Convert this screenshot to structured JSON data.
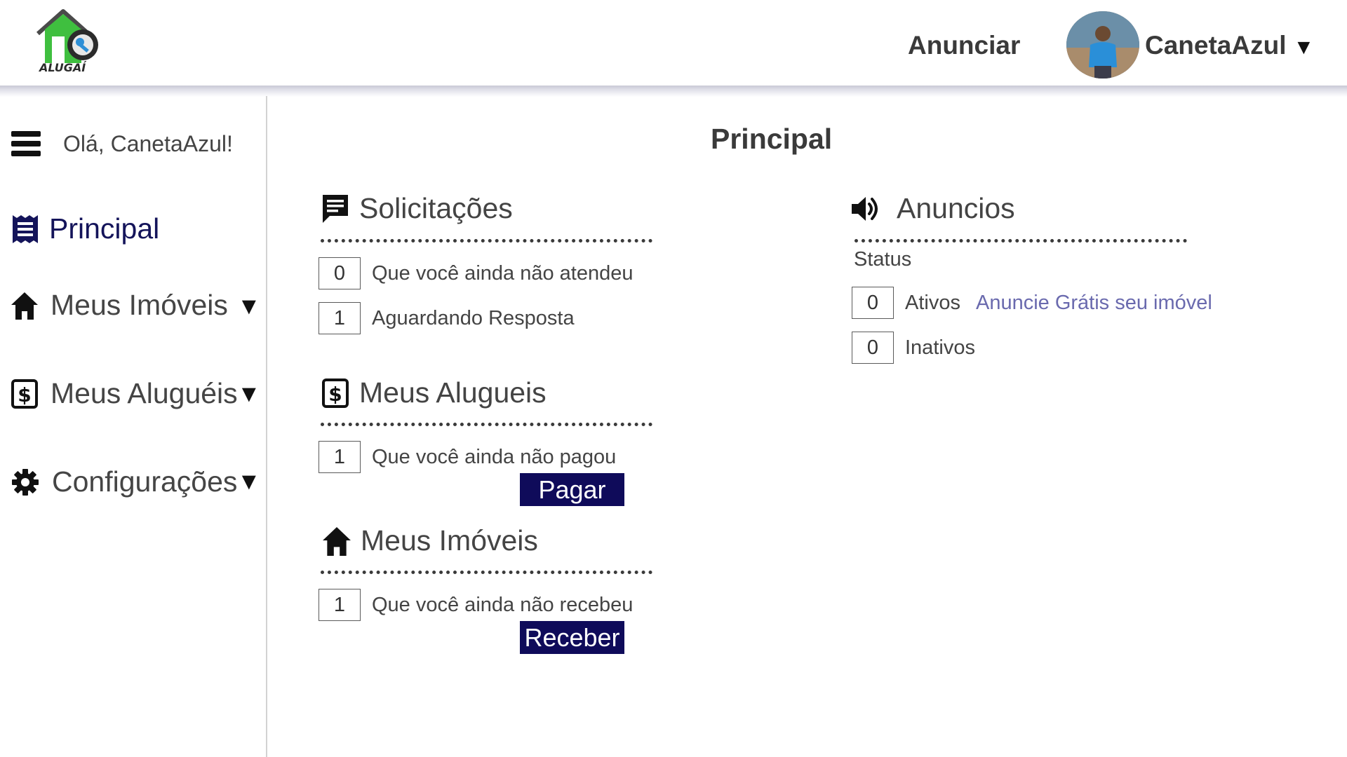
{
  "header": {
    "logo_text": "ALUGAÍ",
    "advertise_label": "Anunciar",
    "user_name": "CanetaAzul",
    "user_caret": "▼"
  },
  "sidebar": {
    "greeting": "Olá, CanetaAzul!",
    "items": [
      {
        "label": "Principal",
        "icon": "receipt-icon",
        "active": true
      },
      {
        "label": "Meus Imóveis",
        "icon": "home-icon",
        "caret": "▼"
      },
      {
        "label": "Meus Aluguéis",
        "icon": "dollar-box-icon",
        "caret": "▼"
      },
      {
        "label": "Configurações",
        "icon": "gear-icon",
        "caret": "▼"
      }
    ]
  },
  "main": {
    "title": "Principal",
    "requests": {
      "title": "Solicitações",
      "rows": [
        {
          "count": "0",
          "label": "Que você ainda não atendeu"
        },
        {
          "count": "1",
          "label": "Aguardando Resposta"
        }
      ]
    },
    "rentals": {
      "title": "Meus Alugueis",
      "rows": [
        {
          "count": "1",
          "label": "Que você ainda não pagou"
        }
      ],
      "button": "Pagar"
    },
    "properties": {
      "title": "Meus Imóveis",
      "rows": [
        {
          "count": "1",
          "label": "Que você ainda não recebeu"
        }
      ],
      "button": "Receber"
    },
    "ads": {
      "title": "Anuncios",
      "status_label": "Status",
      "rows": [
        {
          "count": "0",
          "label": "Ativos"
        },
        {
          "count": "0",
          "label": "Inativos"
        }
      ],
      "promo_link": "Anuncie Grátis seu imóvel"
    }
  },
  "colors": {
    "accent_dark_blue": "#0f0b5a",
    "active_nav": "#14145a",
    "link": "#6a6aae",
    "logo_green": "#3fbf3f"
  }
}
